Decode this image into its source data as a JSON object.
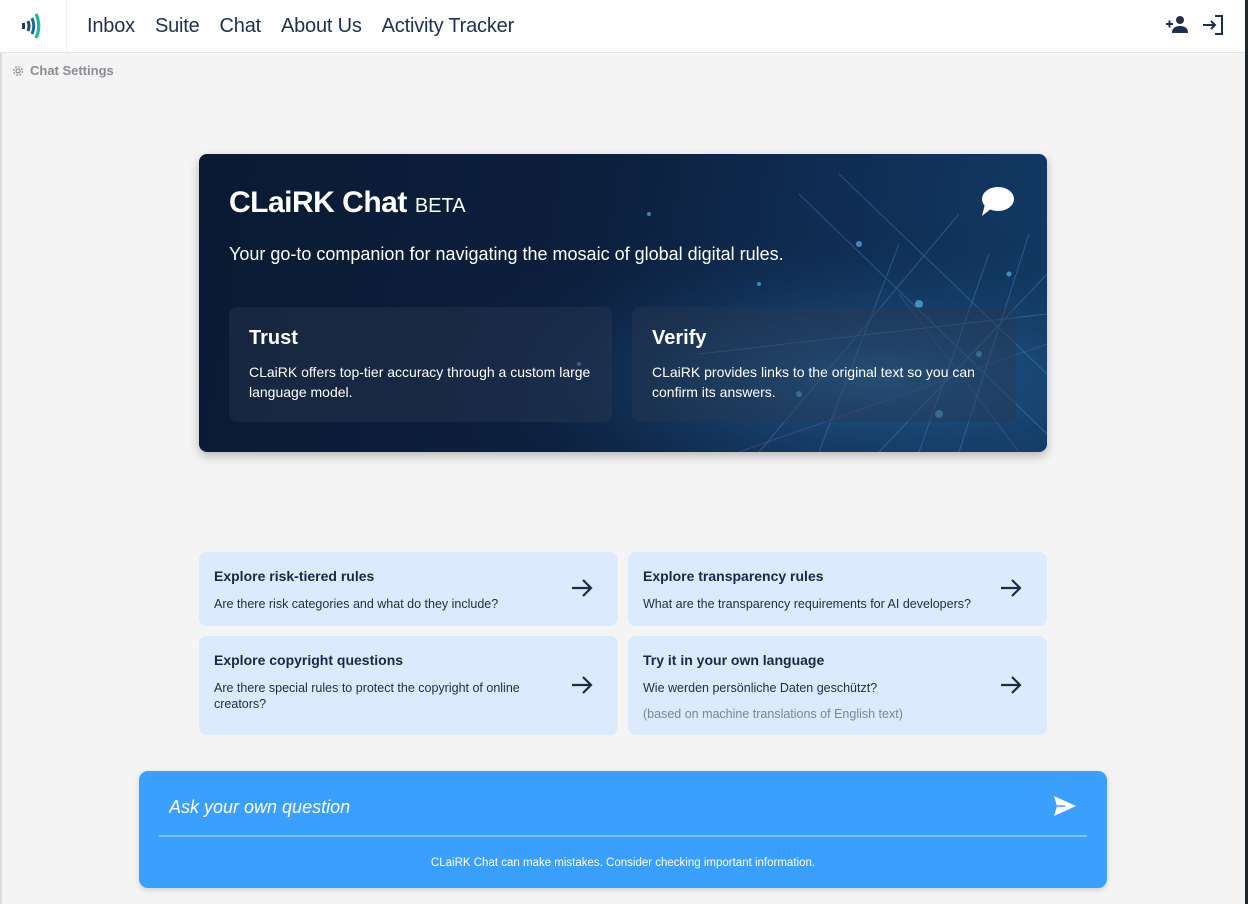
{
  "nav": {
    "items": [
      "Inbox",
      "Suite",
      "Chat",
      "About Us",
      "Activity Tracker"
    ],
    "actions": [
      {
        "icon": "add-user-icon",
        "label": "Sign up"
      },
      {
        "icon": "login-icon",
        "label": "Log in"
      }
    ]
  },
  "chat_settings": {
    "label": "Chat Settings",
    "icon": "gear-icon"
  },
  "hero": {
    "title": "CLaiRK Chat",
    "badge": "BETA",
    "subtitle": "Your go-to companion for navigating the mosaic of global digital rules.",
    "icon": "chat-bubble-icon",
    "cards": [
      {
        "title": "Trust",
        "text": "CLaiRK offers top-tier accuracy through a custom large language model."
      },
      {
        "title": "Verify",
        "text": "CLaiRK provides links to the original text so you can confirm its answers."
      }
    ]
  },
  "suggestions": [
    {
      "title": "Explore risk-tiered rules",
      "question": "Are there risk categories and what do they include?",
      "note": ""
    },
    {
      "title": "Explore transparency rules",
      "question": "What are the transparency requirements for AI developers?",
      "note": ""
    },
    {
      "title": "Explore copyright questions",
      "question": "Are there special rules to protect the copyright of online creators?",
      "note": ""
    },
    {
      "title": "Try it in your own language",
      "question": "Wie werden persönliche Daten geschützt?",
      "note": "(based on machine translations of English text)"
    }
  ],
  "ask": {
    "placeholder": "Ask your own question",
    "value": "",
    "send_icon": "send-icon",
    "disclaimer": "CLaiRK Chat can make mistakes. Consider checking important information."
  },
  "colors": {
    "accent": "#3b9ffe",
    "suggestion_bg": "#dbeafc",
    "nav_text": "#1e3050",
    "hero_bg": "#0c1f3d"
  }
}
